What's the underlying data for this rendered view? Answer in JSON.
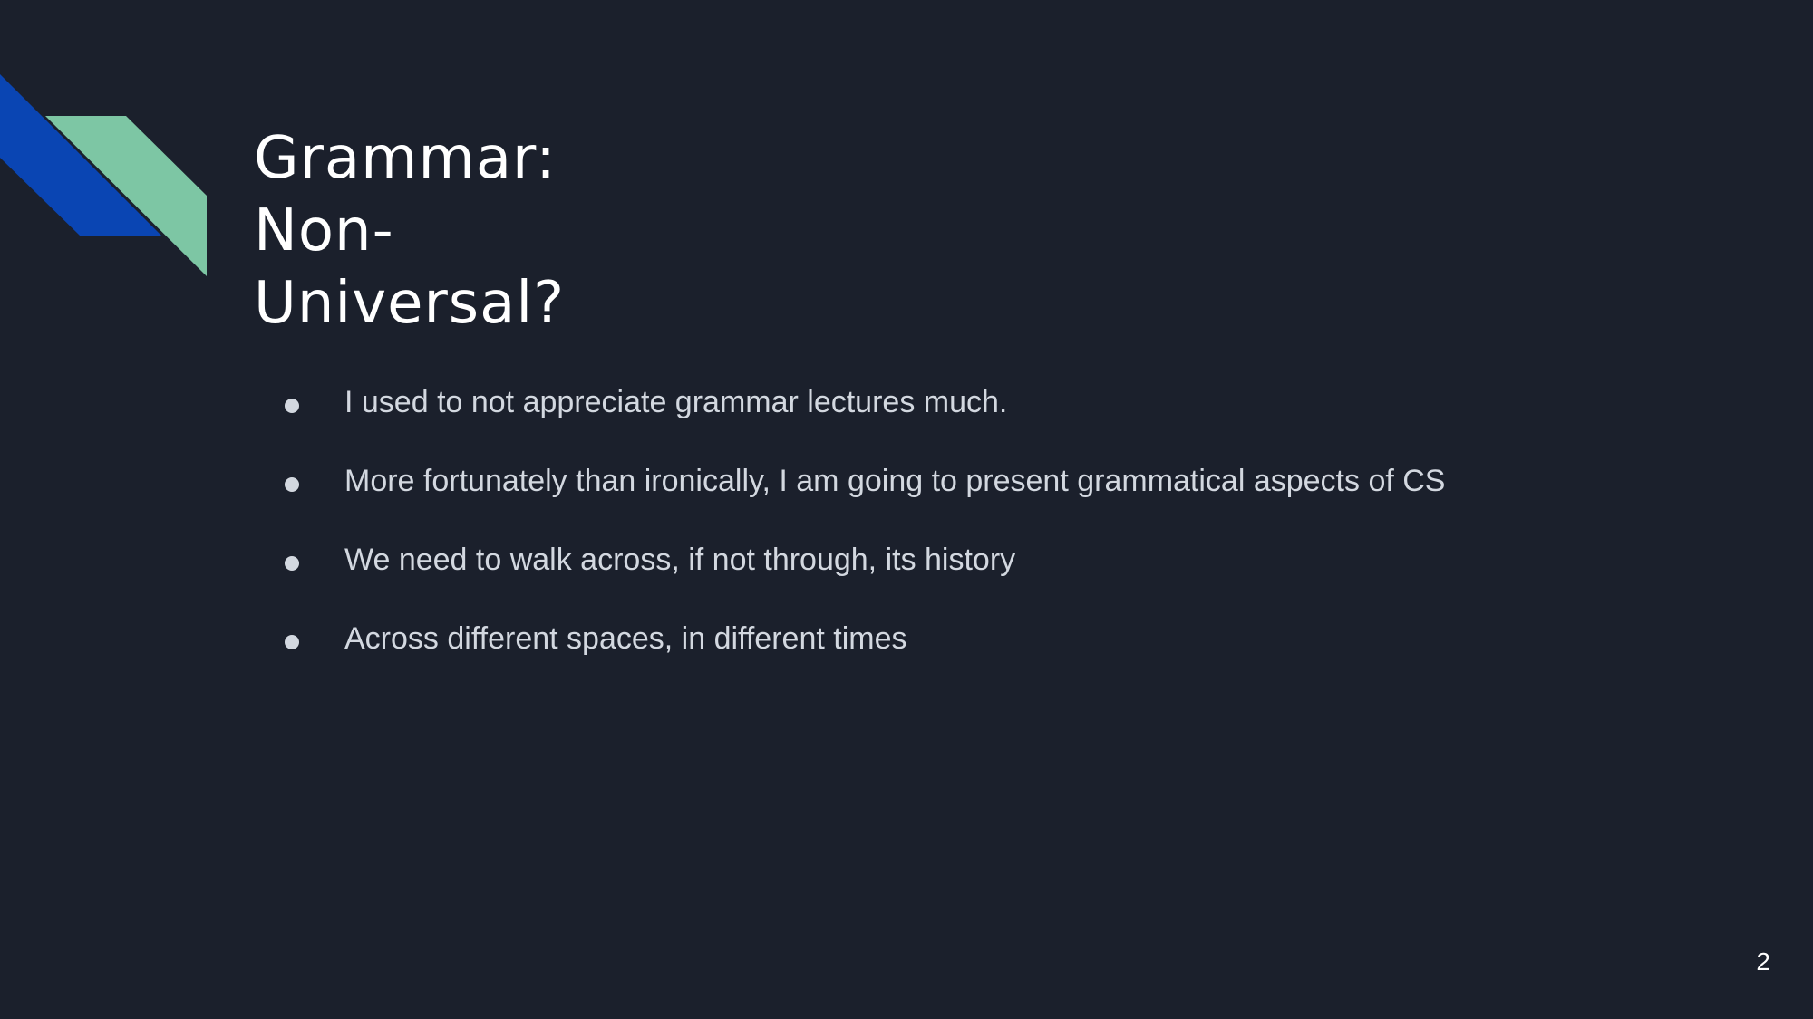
{
  "slide": {
    "title_lines": [
      "Grammar:",
      "Non-",
      "Universal?"
    ],
    "bullets": [
      "I used to not appreciate grammar lectures much.",
      "More fortunately than ironically, I am going to present grammatical aspects of CS",
      "We need to walk across, if not through, its history",
      "Across different spaces, in different times"
    ],
    "page_number": "2"
  },
  "colors": {
    "background": "#1b202c",
    "accent_blue": "#0a45b3",
    "accent_green": "#7dc6a4",
    "title_text": "#ffffff",
    "body_text": "#d3d8e0"
  }
}
